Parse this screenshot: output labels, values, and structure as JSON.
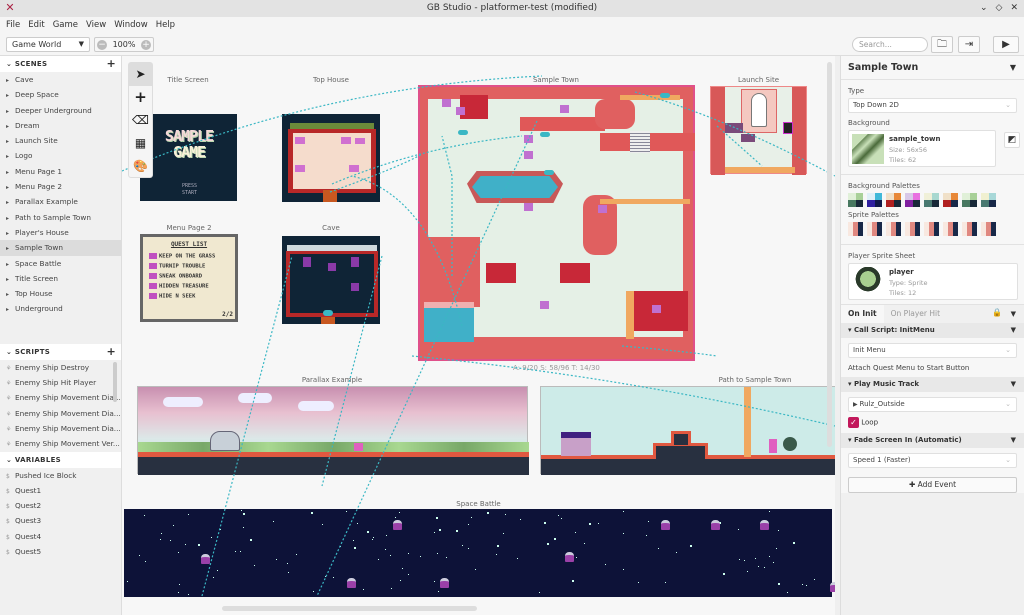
{
  "window": {
    "title": "GB Studio - platformer-test (modified)",
    "controls": [
      "minimize",
      "maximize",
      "close"
    ]
  },
  "menu": [
    "File",
    "Edit",
    "Game",
    "View",
    "Window",
    "Help"
  ],
  "toolbar": {
    "view_select": "Game World",
    "zoom": "100%",
    "search_placeholder": "Search...",
    "icons": [
      "folder-icon",
      "export-icon",
      "play-icon"
    ]
  },
  "sidebar": {
    "scenes_header": "SCENES",
    "scenes": [
      "Cave",
      "Deep Space",
      "Deeper Underground",
      "Dream",
      "Launch Site",
      "Logo",
      "Menu Page 1",
      "Menu Page 2",
      "Parallax Example",
      "Path to Sample Town",
      "Player's House",
      "Sample Town",
      "Space Battle",
      "Title Screen",
      "Top House",
      "Underground"
    ],
    "selected_scene": "Sample Town",
    "scripts_header": "SCRIPTS",
    "scripts": [
      "Enemy Ship Destroy",
      "Enemy Ship Hit Player",
      "Enemy Ship Movement Dia...",
      "Enemy Ship Movement Dia...",
      "Enemy Ship Movement Dia...",
      "Enemy Ship Movement Ver..."
    ],
    "variables_header": "VARIABLES",
    "variables": [
      "Pushed Ice Block",
      "Quest1",
      "Quest2",
      "Quest3",
      "Quest4",
      "Quest5"
    ]
  },
  "world": {
    "tools": [
      "select-tool",
      "add-tool",
      "eraser-tool",
      "collision-tool",
      "paint-tool"
    ],
    "scenes": {
      "title_screen": "Title Screen",
      "top_house": "Top House",
      "sample_town": "Sample Town",
      "launch_site": "Launch Site",
      "menu_page_2": "Menu Page 2",
      "cave": "Cave",
      "parallax": "Parallax Example",
      "path_to_town": "Path to Sample Town",
      "space_battle": "Space Battle"
    },
    "title_screen_text": [
      "SAMPLE",
      "GAME",
      "PRESS",
      "START"
    ],
    "quest_list": {
      "title": "QUEST LIST",
      "items": [
        "KEEP ON THE GRASS",
        "TURNIP TROUBLE",
        "SNEAK ONBOARD",
        "HIDDEN TREASURE",
        "HIDE N SEEK"
      ],
      "page": "2/2"
    },
    "sample_town_stats": "A: 9/20   S: 58/96   T: 14/30",
    "link_color": "#3ab7c4"
  },
  "panel": {
    "scene_name": "Sample Town",
    "type_label": "Type",
    "type_value": "Top Down 2D",
    "background_label": "Background",
    "background": {
      "name": "sample_town",
      "size": "Size:  56x56",
      "tiles": "Tiles:  62"
    },
    "bg_palettes_label": "Background Palettes",
    "bg_palettes": [
      [
        "#e0f0d8",
        "#a8d098",
        "#487860",
        "#182838"
      ],
      [
        "#e0f0f8",
        "#40b8d8",
        "#3020a0",
        "#101848"
      ],
      [
        "#f0e0c8",
        "#e88838",
        "#b02020",
        "#182838"
      ],
      [
        "#d8c8e8",
        "#e870e0",
        "#8020a0",
        "#182838"
      ],
      [
        "#f0f0d8",
        "#a8d8d0",
        "#487870",
        "#182838"
      ],
      [
        "#f0e0c8",
        "#e88838",
        "#b02020",
        "#182848"
      ],
      [
        "#e0f0d8",
        "#a8d098",
        "#487860",
        "#182838"
      ],
      [
        "#f0f0d0",
        "#a8d8d8",
        "#487870",
        "#182848"
      ]
    ],
    "sprite_palettes_label": "Sprite Palettes",
    "sprite_palettes": [
      [
        "#f8e8e0",
        "#e08880",
        "#182848"
      ],
      [
        "#f8e8e0",
        "#e08880",
        "#182848"
      ],
      [
        "#f8e8e0",
        "#e08880",
        "#182848"
      ],
      [
        "#f8e8e0",
        "#e08880",
        "#182848"
      ],
      [
        "#f8e8e0",
        "#e08880",
        "#182848"
      ],
      [
        "#f8e8e0",
        "#e08880",
        "#182848"
      ],
      [
        "#f8e8e0",
        "#e08880",
        "#182848"
      ],
      [
        "#f8e8e0",
        "#e08880",
        "#182848"
      ]
    ],
    "player_sprite_label": "Player Sprite Sheet",
    "player_sprite": {
      "name": "player",
      "type": "Type:  Sprite",
      "tiles": "Tiles:  12"
    },
    "tabs": [
      "On Init",
      "On Player Hit"
    ],
    "active_tab": "On Init",
    "events": [
      {
        "title": "Call Script: InitMenu",
        "select": "Init Menu",
        "note": "Attach Quest Menu to Start Button"
      },
      {
        "title": "Play Music Track",
        "select": "Rulz_Outside",
        "checkbox": "Loop",
        "checked": true
      },
      {
        "title": "Fade Screen In (Automatic)",
        "select": "Speed 1 (Faster)"
      }
    ],
    "add_event": "Add Event",
    "accent": "#c2185b"
  }
}
